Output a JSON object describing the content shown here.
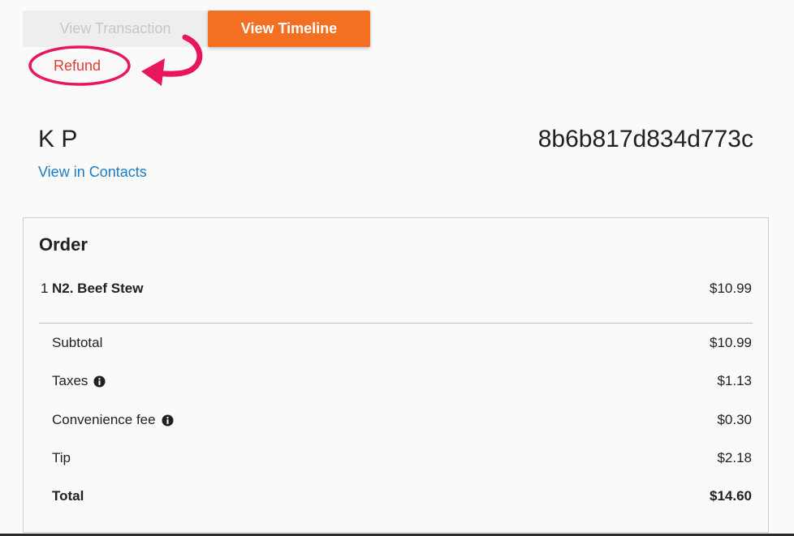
{
  "tabs": {
    "view_transaction": "View Transaction",
    "view_timeline": "View Timeline"
  },
  "refund_label": "Refund",
  "customer": {
    "name": "K P",
    "contacts_link": "View in Contacts"
  },
  "order_id": "8b6b817d834d773c",
  "order": {
    "title": "Order",
    "items": [
      {
        "qty": "1",
        "name": "N2. Beef Stew",
        "price": "$10.99"
      }
    ],
    "summary": {
      "subtotal_label": "Subtotal",
      "subtotal_value": "$10.99",
      "taxes_label": "Taxes",
      "taxes_value": "$1.13",
      "fee_label": "Convenience fee",
      "fee_value": "$0.30",
      "tip_label": "Tip",
      "tip_value": "$2.18",
      "total_label": "Total",
      "total_value": "$14.60"
    }
  },
  "icons": {
    "info": "info-icon",
    "annotation_arrow": "curved-arrow-icon",
    "annotation_circle": "highlight-ellipse"
  },
  "colors": {
    "accent": "#f37022",
    "refund": "#e53935",
    "link": "#1a7dc4",
    "annotation": "#e8175d"
  }
}
